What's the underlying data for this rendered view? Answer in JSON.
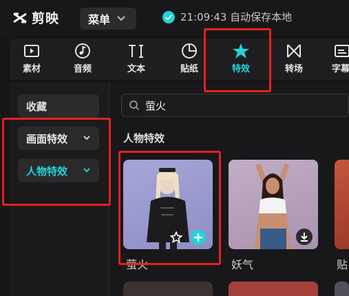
{
  "app": {
    "name": "剪映",
    "menu_label": "菜单",
    "save_status": "21:09:43 自动保存本地"
  },
  "toolbar": {
    "tools": [
      {
        "label": "素材",
        "icon": "media-icon"
      },
      {
        "label": "音频",
        "icon": "music-note-icon"
      },
      {
        "label": "文本",
        "icon": "text-icon"
      },
      {
        "label": "贴纸",
        "icon": "sticker-icon"
      },
      {
        "label": "特效",
        "icon": "effects-star-icon",
        "active": true
      },
      {
        "label": "转场",
        "icon": "transition-icon"
      },
      {
        "label": "字幕",
        "icon": "subtitle-icon"
      }
    ]
  },
  "sidebar": {
    "items": [
      {
        "label": "收藏"
      },
      {
        "label": "画面特效",
        "expandable": true
      },
      {
        "label": "人物特效",
        "expandable": true,
        "active": true
      }
    ]
  },
  "search": {
    "value": "萤火"
  },
  "section": {
    "title": "人物特效"
  },
  "effects": [
    {
      "name": "萤火",
      "status": "added"
    },
    {
      "name": "妖气",
      "status": "download"
    },
    {
      "name": "贴"
    }
  ],
  "colors": {
    "accent": "#22d3d8",
    "highlight": "#e4211f",
    "background": "#151517"
  }
}
